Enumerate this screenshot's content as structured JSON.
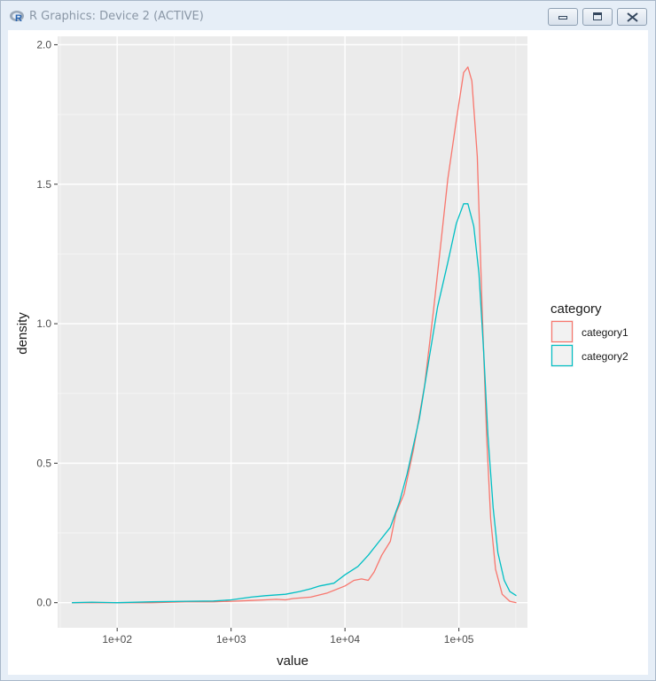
{
  "window": {
    "title": "R Graphics: Device 2 (ACTIVE)",
    "app_icon": "r-logo-icon",
    "buttons": [
      "minimize-icon",
      "maximize-icon",
      "close-icon"
    ]
  },
  "chart_data": {
    "type": "line",
    "xlabel": "value",
    "ylabel": "density",
    "x_scale": "log10",
    "xlim": [
      30,
      400000
    ],
    "ylim": [
      -0.09,
      2.03
    ],
    "x_ticks": [
      100,
      1000,
      10000,
      100000
    ],
    "x_tick_labels": [
      "1e+02",
      "1e+03",
      "1e+04",
      "1e+05"
    ],
    "y_ticks": [
      0,
      0.5,
      1,
      1.5,
      2
    ],
    "y_tick_labels": [
      "0.0",
      "0.5",
      "1.0",
      "1.5",
      "2.0"
    ],
    "grid": true,
    "legend_title": "category",
    "legend_position": "right",
    "series": [
      {
        "name": "category1",
        "color": "#f8766d",
        "points": [
          [
            40,
            0.0
          ],
          [
            60,
            0.0
          ],
          [
            100,
            0.0
          ],
          [
            200,
            0.0
          ],
          [
            400,
            0.003
          ],
          [
            700,
            0.003
          ],
          [
            1000,
            0.005
          ],
          [
            1500,
            0.008
          ],
          [
            2000,
            0.01
          ],
          [
            2500,
            0.012
          ],
          [
            3000,
            0.01
          ],
          [
            3500,
            0.015
          ],
          [
            5000,
            0.02
          ],
          [
            7000,
            0.035
          ],
          [
            10000,
            0.06
          ],
          [
            12000,
            0.08
          ],
          [
            14000,
            0.085
          ],
          [
            16000,
            0.08
          ],
          [
            18000,
            0.11
          ],
          [
            21000,
            0.17
          ],
          [
            25000,
            0.22
          ],
          [
            28000,
            0.32
          ],
          [
            33000,
            0.39
          ],
          [
            40000,
            0.55
          ],
          [
            50000,
            0.78
          ],
          [
            60000,
            1.05
          ],
          [
            70000,
            1.3
          ],
          [
            80000,
            1.52
          ],
          [
            95000,
            1.73
          ],
          [
            110000,
            1.9
          ],
          [
            120000,
            1.92
          ],
          [
            130000,
            1.87
          ],
          [
            145000,
            1.6
          ],
          [
            160000,
            1.05
          ],
          [
            175000,
            0.6
          ],
          [
            190000,
            0.3
          ],
          [
            210000,
            0.12
          ],
          [
            240000,
            0.03
          ],
          [
            280000,
            0.005
          ],
          [
            320000,
            0.0
          ]
        ]
      },
      {
        "name": "category2",
        "color": "#00bfc4",
        "points": [
          [
            40,
            0.0
          ],
          [
            60,
            0.002
          ],
          [
            100,
            0.0
          ],
          [
            200,
            0.003
          ],
          [
            400,
            0.005
          ],
          [
            700,
            0.006
          ],
          [
            1000,
            0.01
          ],
          [
            1500,
            0.02
          ],
          [
            2000,
            0.025
          ],
          [
            3000,
            0.03
          ],
          [
            4000,
            0.04
          ],
          [
            5000,
            0.05
          ],
          [
            6000,
            0.06
          ],
          [
            8000,
            0.07
          ],
          [
            10000,
            0.1
          ],
          [
            13000,
            0.13
          ],
          [
            16000,
            0.17
          ],
          [
            20000,
            0.22
          ],
          [
            25000,
            0.27
          ],
          [
            30000,
            0.36
          ],
          [
            35000,
            0.46
          ],
          [
            45000,
            0.66
          ],
          [
            55000,
            0.88
          ],
          [
            65000,
            1.06
          ],
          [
            80000,
            1.22
          ],
          [
            95000,
            1.36
          ],
          [
            110000,
            1.43
          ],
          [
            120000,
            1.43
          ],
          [
            135000,
            1.35
          ],
          [
            150000,
            1.18
          ],
          [
            165000,
            0.9
          ],
          [
            180000,
            0.6
          ],
          [
            200000,
            0.34
          ],
          [
            220000,
            0.18
          ],
          [
            250000,
            0.08
          ],
          [
            280000,
            0.04
          ],
          [
            320000,
            0.025
          ]
        ]
      }
    ]
  }
}
